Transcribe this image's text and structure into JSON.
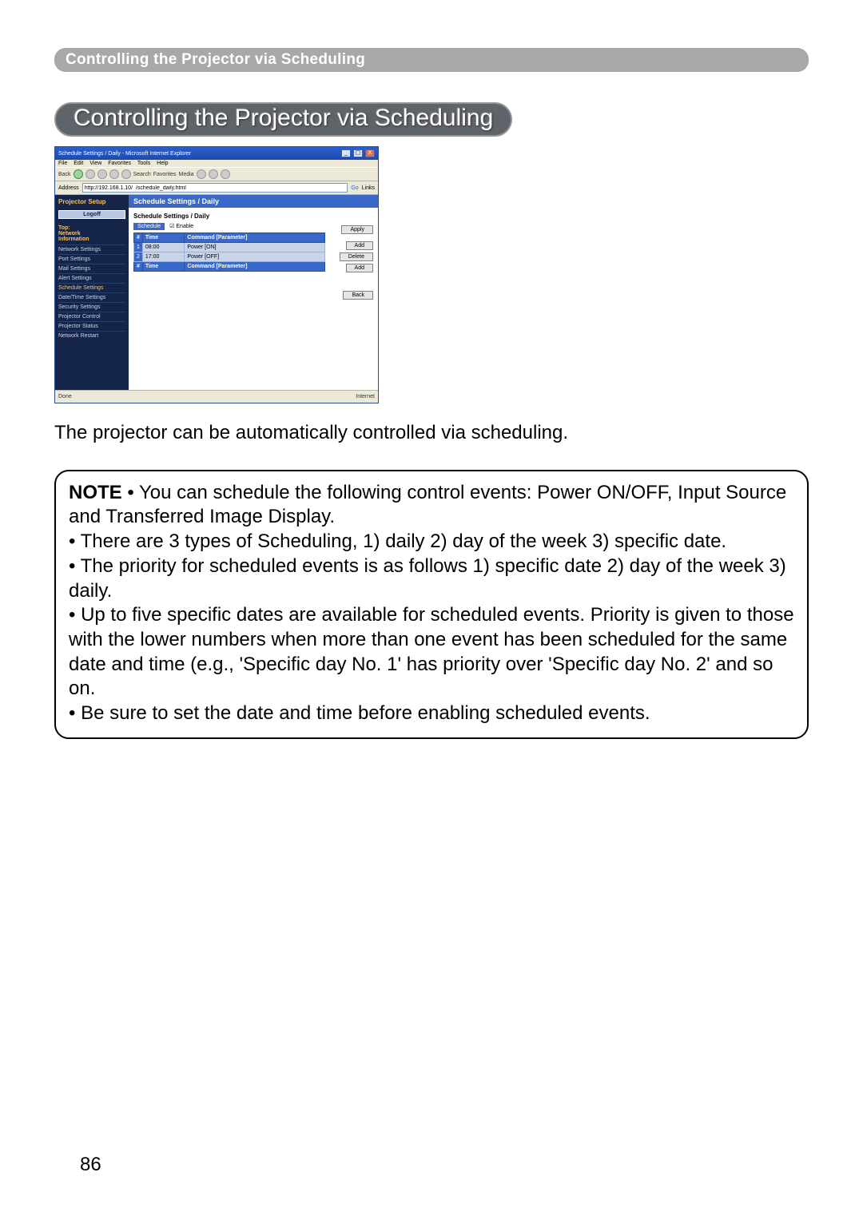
{
  "header": {
    "text": "Controlling the Projector via Scheduling"
  },
  "title": "Controlling the Projector via Scheduling",
  "ie": {
    "title": "Schedule Settings / Daily - Microsoft Internet Explorer",
    "menubar": [
      "File",
      "Edit",
      "View",
      "Favorites",
      "Tools",
      "Help"
    ],
    "toolbar": {
      "back": "Back",
      "search": "Search",
      "favorites": "Favorites",
      "media": "Media"
    },
    "addr_label": "Address",
    "address": "http://192.168.1.10/  /schedule_daily.html",
    "go": "Go",
    "links": "Links",
    "sidebar": {
      "title": "Projector Setup",
      "logon": "Logoff",
      "top_label": "Top:\nNetwork\nInformation",
      "items": [
        "Network Settings",
        "Port Settings",
        "Mail Settings",
        "Alert Settings",
        "Schedule Settings",
        "Date/Time Settings",
        "Security Settings",
        "Projector Control",
        "Projector Status",
        "Network Restart"
      ],
      "active_index": 4
    },
    "main": {
      "header": "Schedule Settings / Daily",
      "subheader": "Schedule Settings / Daily",
      "enable_label": "Schedule",
      "enable_value": "Enable",
      "apply": "Apply",
      "add": "Add",
      "delete": "Delete",
      "add2": "Add",
      "back": "Back",
      "table": {
        "cols": [
          "#",
          "Time",
          "Command [Parameter]"
        ],
        "rows": [
          {
            "n": "1",
            "time": "08:00",
            "cmd": "Power [ON]"
          },
          {
            "n": "2",
            "time": "17:00",
            "cmd": "Power [OFF]"
          }
        ],
        "input_cols": [
          "#",
          "Time",
          "Command [Parameter]"
        ]
      }
    },
    "status_left": "Done",
    "status_right": "Internet"
  },
  "body_text": "The projector can be automatically controlled via scheduling.",
  "note": {
    "label": "NOTE",
    "b1": "• You can schedule the following control events: Power ON/OFF, Input Source and Transferred Image Display.",
    "b2": "• There are 3 types of Scheduling, 1) daily 2) day of the week 3) specific date.",
    "b3": "• The priority for scheduled events is as follows 1) specific date 2) day of the week 3) daily.",
    "b4": "• Up to five specific dates are available for scheduled events. Priority is given to those with the lower numbers when more than one event has been scheduled for the same date and time (e.g., 'Specific day No. 1' has priority over 'Specific day No. 2' and so on.",
    "b5": "• Be sure to set the date and time before enabling scheduled events."
  },
  "page_number": "86"
}
